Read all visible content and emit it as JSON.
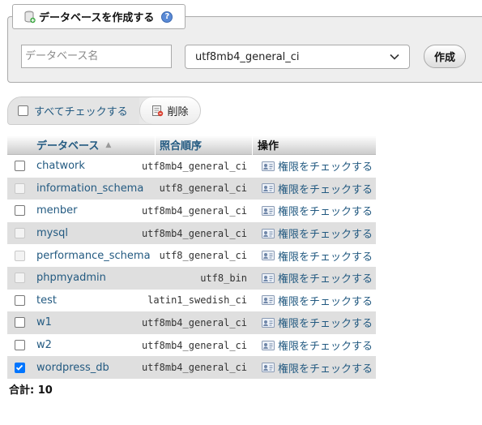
{
  "create_panel": {
    "legend_title": "データベースを作成する",
    "name_placeholder": "データベース名",
    "collation_selected": "utf8mb4_general_ci",
    "create_label": "作成"
  },
  "toolbar": {
    "check_all_label": "すべてチェックする",
    "delete_label": "削除"
  },
  "table": {
    "headers": {
      "database": "データベース",
      "collation": "照合順序",
      "action": "操作"
    },
    "rows": [
      {
        "name": "chatwork",
        "collation": "utf8mb4_general_ci",
        "action": "権限をチェックする"
      },
      {
        "name": "information_schema",
        "collation": "utf8_general_ci",
        "action": "権限をチェックする"
      },
      {
        "name": "menber",
        "collation": "utf8mb4_general_ci",
        "action": "権限をチェックする"
      },
      {
        "name": "mysql",
        "collation": "utf8mb4_general_ci",
        "action": "権限をチェックする"
      },
      {
        "name": "performance_schema",
        "collation": "utf8_general_ci",
        "action": "権限をチェックする"
      },
      {
        "name": "phpmyadmin",
        "collation": "utf8_bin",
        "action": "権限をチェックする"
      },
      {
        "name": "test",
        "collation": "latin1_swedish_ci",
        "action": "権限をチェックする"
      },
      {
        "name": "w1",
        "collation": "utf8mb4_general_ci",
        "action": "権限をチェックする"
      },
      {
        "name": "w2",
        "collation": "utf8mb4_general_ci",
        "action": "権限をチェックする"
      },
      {
        "name": "wordpress_db",
        "collation": "utf8mb4_general_ci",
        "action": "権限をチェックする"
      }
    ]
  },
  "total": {
    "label": "合計:",
    "value": "10"
  }
}
